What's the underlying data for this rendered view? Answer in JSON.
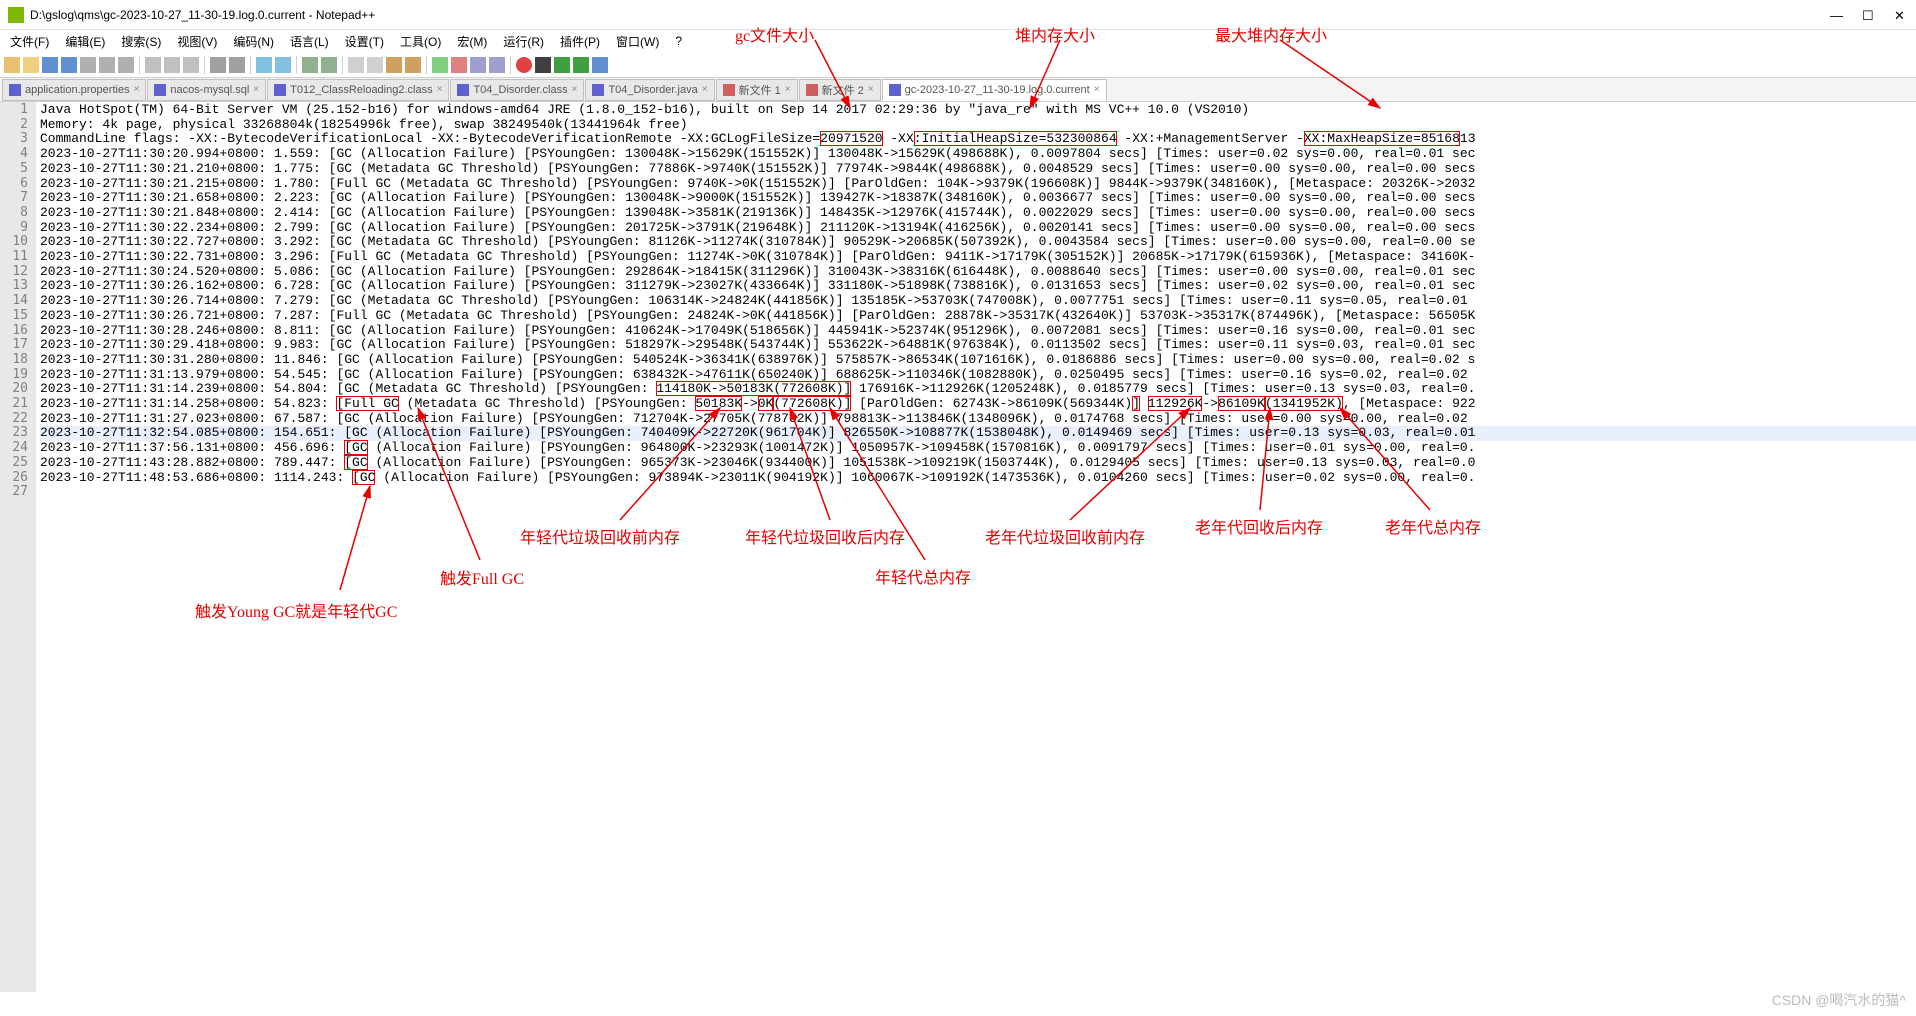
{
  "titlebar": {
    "title": "D:\\gslog\\qms\\gc-2023-10-27_11-30-19.log.0.current - Notepad++"
  },
  "menu": {
    "file": "文件(F)",
    "edit": "编辑(E)",
    "search": "搜索(S)",
    "view": "视图(V)",
    "encoding": "编码(N)",
    "language": "语言(L)",
    "settings": "设置(T)",
    "tools": "工具(O)",
    "macro": "宏(M)",
    "run": "运行(R)",
    "plugins": "插件(P)",
    "window": "窗口(W)",
    "help": "?"
  },
  "tabs": [
    {
      "label": "application.properties"
    },
    {
      "label": "nacos-mysql.sql"
    },
    {
      "label": "T012_ClassReloading2.class"
    },
    {
      "label": "T04_Disorder.class"
    },
    {
      "label": "T04_Disorder.java"
    },
    {
      "label": "新文件 1"
    },
    {
      "label": "新文件 2"
    },
    {
      "label": "gc-2023-10-27_11-30-19.log.0.current",
      "active": true
    }
  ],
  "lines": [
    "Java HotSpot(TM) 64-Bit Server VM (25.152-b16) for windows-amd64 JRE (1.8.0_152-b16), built on Sep 14 2017 02:29:36 by \"java_re\" with MS VC++ 10.0 (VS2010)",
    "Memory: 4k page, physical 33268804k(18254996k free), swap 38249540k(13441964k free)",
    "CommandLine flags: -XX:-BytecodeVerificationLocal -XX:-BytecodeVerificationRemote -XX:GCLogFileSize=20971520 -XX:InitialHeapSize=532300864 -XX:+ManagementServer -XX:MaxHeapSize=8516813",
    "2023-10-27T11:30:20.994+0800: 1.559: [GC (Allocation Failure) [PSYoungGen: 130048K->15629K(151552K)] 130048K->15629K(498688K), 0.0097804 secs] [Times: user=0.02 sys=0.00, real=0.01 sec",
    "2023-10-27T11:30:21.210+0800: 1.775: [GC (Metadata GC Threshold) [PSYoungGen: 77886K->9740K(151552K)] 77974K->9844K(498688K), 0.0048529 secs] [Times: user=0.00 sys=0.00, real=0.00 secs",
    "2023-10-27T11:30:21.215+0800: 1.780: [Full GC (Metadata GC Threshold) [PSYoungGen: 9740K->0K(151552K)] [ParOldGen: 104K->9379K(196608K)] 9844K->9379K(348160K), [Metaspace: 20326K->2032",
    "2023-10-27T11:30:21.658+0800: 2.223: [GC (Allocation Failure) [PSYoungGen: 130048K->9000K(151552K)] 139427K->18387K(348160K), 0.0036677 secs] [Times: user=0.00 sys=0.00, real=0.00 secs",
    "2023-10-27T11:30:21.848+0800: 2.414: [GC (Allocation Failure) [PSYoungGen: 139048K->3581K(219136K)] 148435K->12976K(415744K), 0.0022029 secs] [Times: user=0.00 sys=0.00, real=0.00 secs",
    "2023-10-27T11:30:22.234+0800: 2.799: [GC (Allocation Failure) [PSYoungGen: 201725K->3791K(219648K)] 211120K->13194K(416256K), 0.0020141 secs] [Times: user=0.00 sys=0.00, real=0.00 secs",
    "2023-10-27T11:30:22.727+0800: 3.292: [GC (Metadata GC Threshold) [PSYoungGen: 81126K->11274K(310784K)] 90529K->20685K(507392K), 0.0043584 secs] [Times: user=0.00 sys=0.00, real=0.00 se",
    "2023-10-27T11:30:22.731+0800: 3.296: [Full GC (Metadata GC Threshold) [PSYoungGen: 11274K->0K(310784K)] [ParOldGen: 9411K->17179K(305152K)] 20685K->17179K(615936K), [Metaspace: 34160K-",
    "2023-10-27T11:30:24.520+0800: 5.086: [GC (Allocation Failure) [PSYoungGen: 292864K->18415K(311296K)] 310043K->38316K(616448K), 0.0088640 secs] [Times: user=0.00 sys=0.00, real=0.01 sec",
    "2023-10-27T11:30:26.162+0800: 6.728: [GC (Allocation Failure) [PSYoungGen: 311279K->23027K(433664K)] 331180K->51898K(738816K), 0.0131653 secs] [Times: user=0.02 sys=0.00, real=0.01 sec",
    "2023-10-27T11:30:26.714+0800: 7.279: [GC (Metadata GC Threshold) [PSYoungGen: 106314K->24824K(441856K)] 135185K->53703K(747008K), 0.0077751 secs] [Times: user=0.11 sys=0.05, real=0.01 ",
    "2023-10-27T11:30:26.721+0800: 7.287: [Full GC (Metadata GC Threshold) [PSYoungGen: 24824K->0K(441856K)] [ParOldGen: 28878K->35317K(432640K)] 53703K->35317K(874496K), [Metaspace: 56505K",
    "2023-10-27T11:30:28.246+0800: 8.811: [GC (Allocation Failure) [PSYoungGen: 410624K->17049K(518656K)] 445941K->52374K(951296K), 0.0072081 secs] [Times: user=0.16 sys=0.00, real=0.01 sec",
    "2023-10-27T11:30:29.418+0800: 9.983: [GC (Allocation Failure) [PSYoungGen: 518297K->29548K(543744K)] 553622K->64881K(976384K), 0.0113502 secs] [Times: user=0.11 sys=0.03, real=0.01 sec",
    "2023-10-27T11:30:31.280+0800: 11.846: [GC (Allocation Failure) [PSYoungGen: 540524K->36341K(638976K)] 575857K->86534K(1071616K), 0.0186886 secs] [Times: user=0.00 sys=0.00, real=0.02 s",
    "2023-10-27T11:31:13.979+0800: 54.545: [GC (Allocation Failure) [PSYoungGen: 638432K->47611K(650240K)] 688625K->110346K(1082880K), 0.0250495 secs] [Times: user=0.16 sys=0.02, real=0.02 ",
    "2023-10-27T11:31:14.239+0800: 54.804: [GC (Metadata GC Threshold) [PSYoungGen: 114180K->50183K(772608K)] 176916K->112926K(1205248K), 0.0185779 secs] [Times: user=0.13 sys=0.03, real=0.",
    "2023-10-27T11:31:14.258+0800: 54.823: [Full GC (Metadata GC Threshold) [PSYoungGen: 50183K->0K(772608K)] [ParOldGen: 62743K->86109K(569344K)] 112926K->86109K(1341952K), [Metaspace: 922",
    "2023-10-27T11:31:27.023+0800: 67.587: [GC (Allocation Failure) [PSYoungGen: 712704K->27705K(778752K)] 798813K->113846K(1348096K), 0.0174768 secs] [Times: user=0.00 sys=0.00, real=0.02 ",
    "2023-10-27T11:32:54.085+0800: 154.651: [GC (Allocation Failure) [PSYoungGen: 740409K->22720K(961704K)] 826550K->108877K(1538048K), 0.0149469 secs] [Times: user=0.13 sys=0.03, real=0.01",
    "2023-10-27T11:37:56.131+0800: 456.696: [GC (Allocation Failure) [PSYoungGen: 964800K->23293K(1001472K)] 1050957K->109458K(1570816K), 0.0091797 secs] [Times: user=0.01 sys=0.00, real=0.",
    "2023-10-27T11:43:28.882+0800: 789.447: [GC (Allocation Failure) [PSYoungGen: 965373K->23046K(934400K)] 1051538K->109219K(1503744K), 0.0129405 secs] [Times: user=0.13 sys=0.03, real=0.0",
    "2023-10-27T11:48:53.686+0800: 1114.243: [GC (Allocation Failure) [PSYoungGen: 973894K->23011K(904192K)] 1060067K->109192K(1473536K), 0.0104260 secs] [Times: user=0.02 sys=0.00, real=0."
  ],
  "annotations": {
    "gc_file_size": "gc文件大小",
    "heap_size": "堆内存大小",
    "max_heap_size": "最大堆内存大小",
    "young_gc_label": "触发Young GC就是年轻代GC",
    "full_gc_label": "触发Full GC",
    "young_before": "年轻代垃圾回收前内存",
    "young_after": "年轻代垃圾回收后内存",
    "young_total": "年轻代总内存",
    "old_before": "老年代垃圾回收前内存",
    "old_after": "老年代回收后内存",
    "old_total": "老年代总内存"
  },
  "watermark": "CSDN @喝汽水的猫^"
}
